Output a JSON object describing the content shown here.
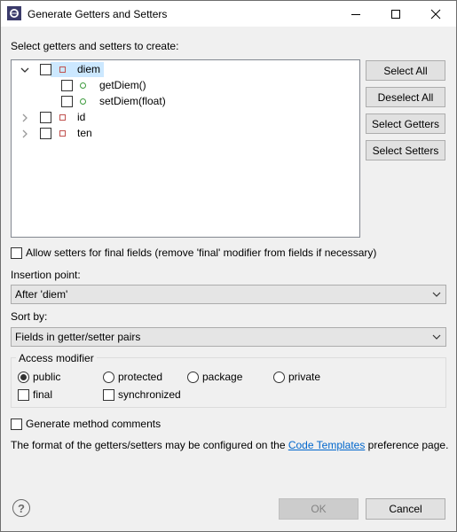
{
  "window": {
    "title": "Generate Getters and Setters",
    "icon": "eclipse-icon"
  },
  "tree_section": {
    "label": "Select getters and setters to create:",
    "items": [
      {
        "label": "diem",
        "expanded": true,
        "checked": false,
        "selected": true,
        "icon": "field-icon",
        "children": [
          {
            "label": "getDiem()",
            "checked": false,
            "icon": "method-icon"
          },
          {
            "label": "setDiem(float)",
            "checked": false,
            "icon": "method-icon"
          }
        ]
      },
      {
        "label": "id",
        "expanded": false,
        "checked": false,
        "icon": "field-icon"
      },
      {
        "label": "ten",
        "expanded": false,
        "checked": false,
        "icon": "field-icon"
      }
    ]
  },
  "side_buttons": {
    "select_all": "Select All",
    "deselect_all": "Deselect All",
    "select_getters": "Select Getters",
    "select_setters": "Select Setters"
  },
  "allow_setters_final": {
    "label": "Allow setters for final fields (remove 'final' modifier from fields if necessary)",
    "checked": false
  },
  "insertion_point": {
    "label": "Insertion point:",
    "value": "After 'diem'"
  },
  "sort_by": {
    "label": "Sort by:",
    "value": "Fields in getter/setter pairs"
  },
  "access_modifier": {
    "title": "Access modifier",
    "options": [
      "public",
      "protected",
      "package",
      "private"
    ],
    "selected": "public",
    "final_label": "final",
    "synchronized_label": "synchronized"
  },
  "generate_comments": {
    "label": "Generate method comments",
    "checked": false
  },
  "footer_note": {
    "prefix": "The format of the getters/setters may be configured on the ",
    "link": "Code Templates",
    "suffix": " preference page."
  },
  "buttons": {
    "ok": "OK",
    "cancel": "Cancel",
    "help": "?"
  },
  "colors": {
    "selection": "#cce8ff",
    "link": "#0066cc",
    "field_icon": "#c0504d",
    "method_icon": "#3c9a3c"
  }
}
